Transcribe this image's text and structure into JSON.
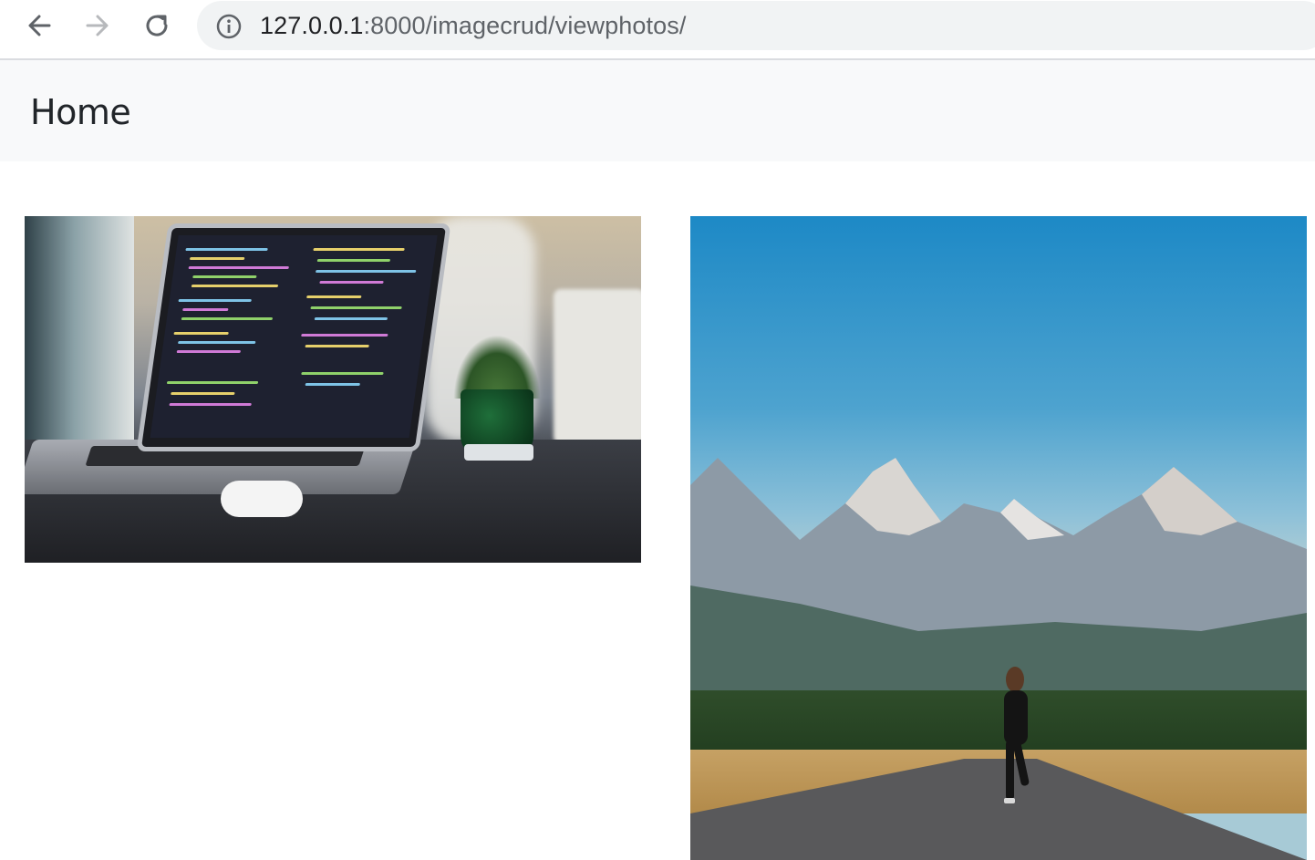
{
  "browser": {
    "url_host": "127.0.0.1",
    "url_path": ":8000/imagecrud/viewphotos/"
  },
  "navbar": {
    "brand": "Home"
  },
  "photos": [
    {
      "subject": "laptop-with-code-and-plant"
    },
    {
      "subject": "runner-on-road-before-mountains"
    }
  ],
  "colors": {
    "navbar_bg": "#f8f9fa",
    "omnibox_bg": "#f1f3f4",
    "text": "#212529"
  }
}
